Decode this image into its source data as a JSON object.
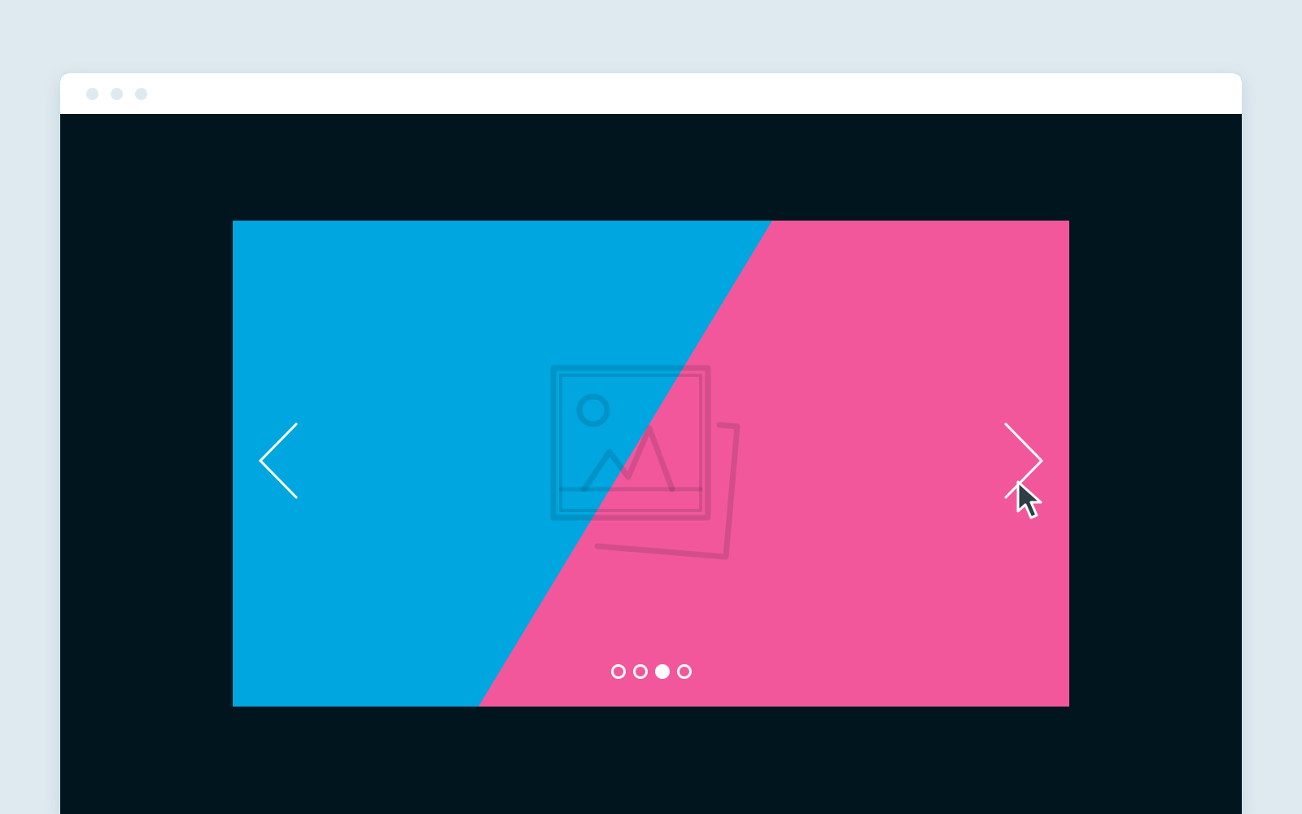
{
  "window": {
    "titlebar_dots": [
      "close-dot",
      "minimize-dot",
      "maximize-dot"
    ]
  },
  "colors": {
    "page_background": "#dfeaf0",
    "viewport_background": "#01151f",
    "slide_left": "#00a6e0",
    "slide_right": "#f2579c",
    "arrow_color": "#ffffff"
  },
  "carousel": {
    "slide_count": 4,
    "active_slide_index": 2,
    "slide_placeholder_icon": "image-placeholder-icon",
    "prev_icon": "chevron-left-icon",
    "next_icon": "chevron-right-icon"
  },
  "pointer": {
    "icon": "mouse-cursor-icon",
    "hovering": "next-arrow"
  }
}
